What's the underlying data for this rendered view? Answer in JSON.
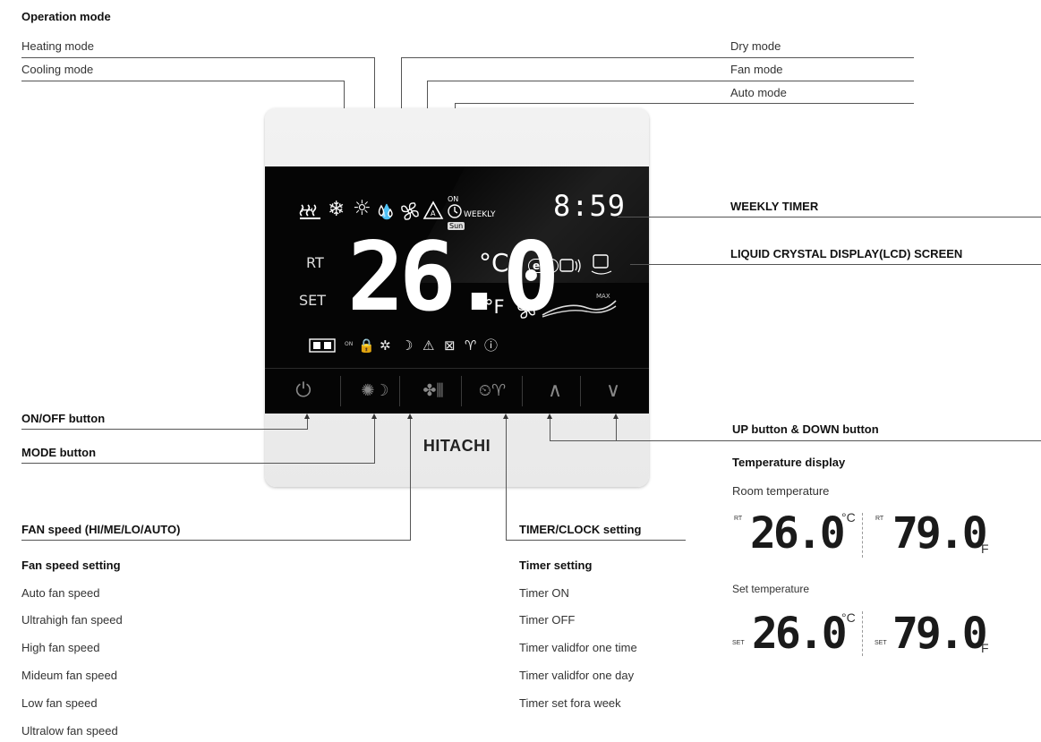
{
  "labels": {
    "operation_mode": "Operation mode",
    "heating_mode": "Heating mode",
    "cooling_mode": "Cooling mode",
    "dry_mode": "Dry mode",
    "fan_mode": "Fan mode",
    "auto_mode": "Auto mode",
    "weekly_timer": "WEEKLY TIMER",
    "lcd_screen": "LIQUID CRYSTAL DISPLAY(LCD) SCREEN",
    "onoff_button": "ON/OFF button",
    "mode_button": "MODE button",
    "up_down_button": "UP button & DOWN button",
    "fan_speed": "FAN speed (HI/ME/LO/AUTO)",
    "timer_clock": "TIMER/CLOCK setting"
  },
  "fan_speed_setting": {
    "title": "Fan speed setting",
    "items": [
      "Auto fan speed",
      "Ultrahigh fan speed",
      "High fan speed",
      "Mideum fan speed",
      "Low fan speed",
      "Ultralow fan speed"
    ]
  },
  "timer_setting": {
    "title": "Timer setting",
    "items": [
      "Timer ON",
      "Timer OFF",
      "Timer validfor one time",
      "Timer validfor one day",
      "Timer set fora week"
    ]
  },
  "temperature_display": {
    "title": "Temperature display",
    "room_label": "Room temperature",
    "set_label": "Set temperature",
    "rt_tag": "RT",
    "set_tag": "SET",
    "celsius_value": "26.0",
    "fahrenheit_value": "79.0",
    "celsius_unit": "°C",
    "fahrenheit_unit": "F"
  },
  "lcd": {
    "rt": "RT",
    "set": "SET",
    "temp": "26.0",
    "unit_c": "°C",
    "unit_f": "°F",
    "eco": "eco",
    "timer_on": "ON",
    "weekly": "WEEKLY",
    "day": "Sun",
    "clock": "8:59",
    "max": "MAX",
    "small_on": "ON"
  },
  "brand": "HITACHI",
  "icons": {
    "heating": "heating-icon",
    "cooling": "snowflake-icon",
    "dry": "dry-drop-icon",
    "fan": "fan-icon",
    "auto": "auto-triangle-icon",
    "clock": "clock-icon",
    "power": "power-icon",
    "mode": "mode-icon",
    "timer": "timer-icon",
    "up": "up-arrow-icon",
    "down": "down-arrow-icon"
  }
}
